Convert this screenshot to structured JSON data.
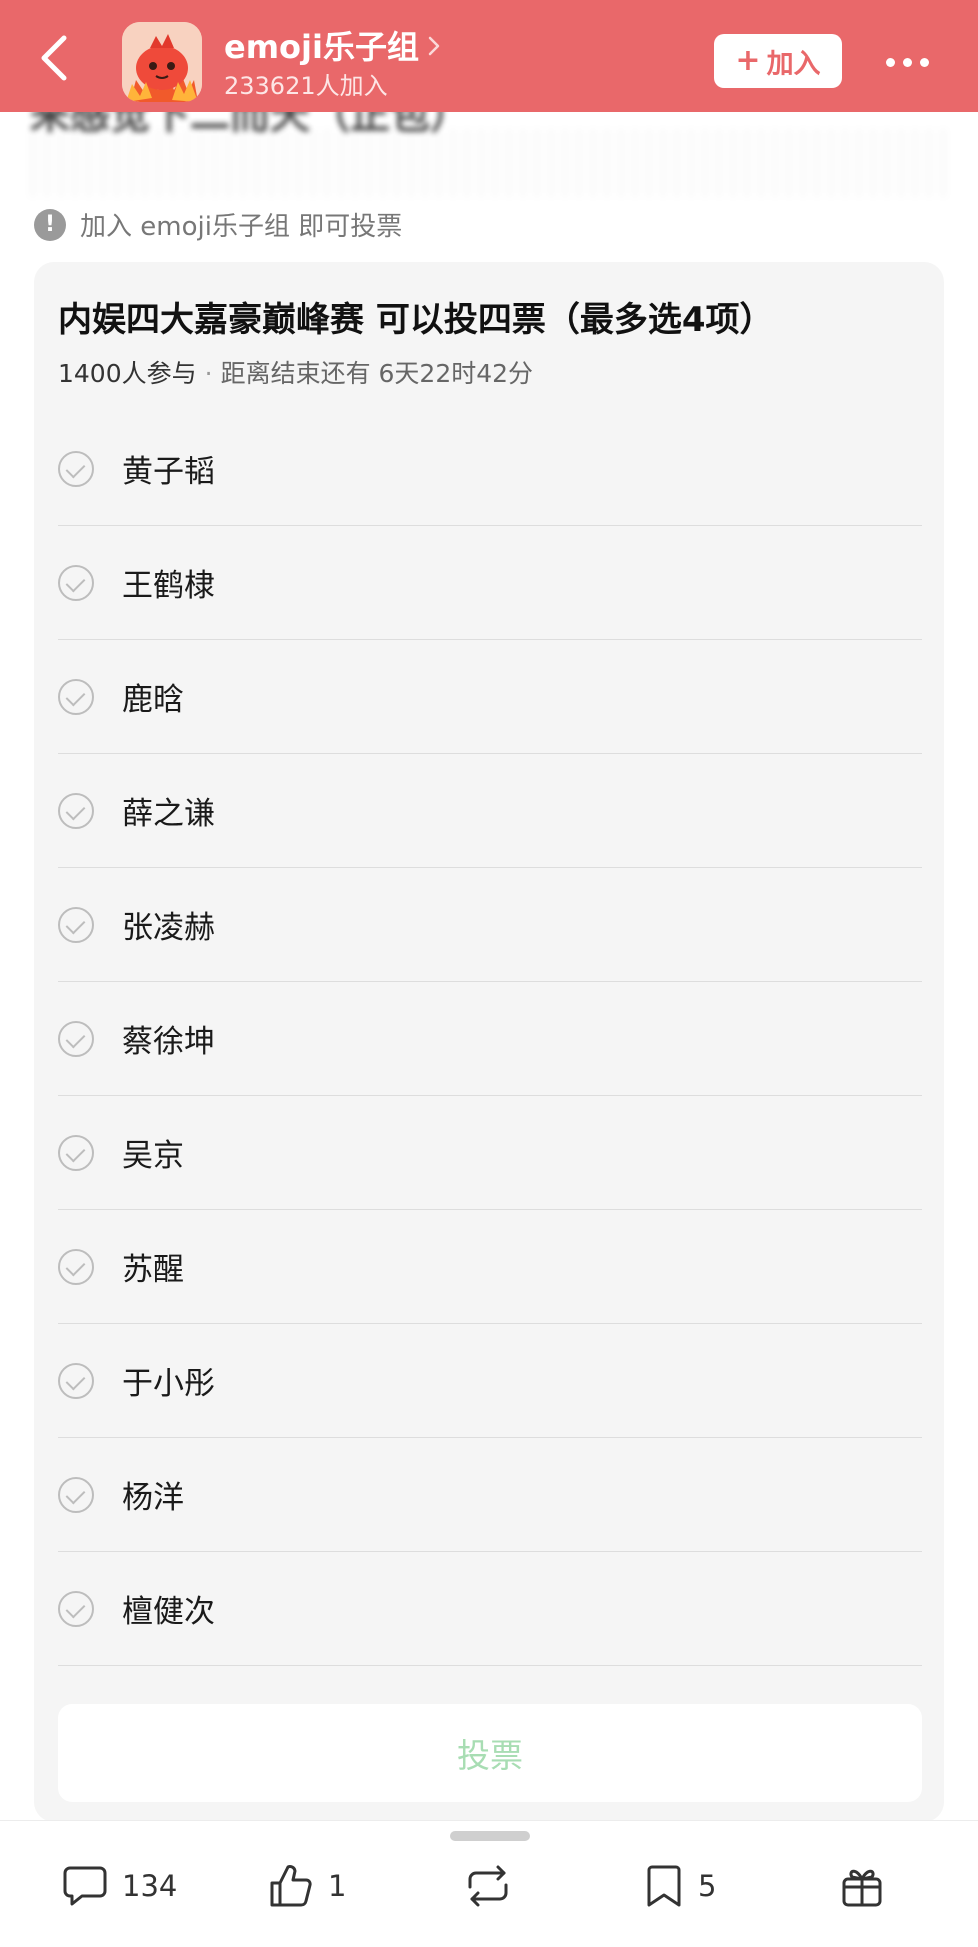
{
  "header": {
    "group_name": "emoji乐子组",
    "member_count": "233621人加入",
    "join_label": "加入",
    "join_plus": "+",
    "accent_color": "#e9686a"
  },
  "background_title": "来感觉下二而天（正包）",
  "notice": {
    "icon_glyph": "!",
    "text": "加入 emoji乐子组 即可投票"
  },
  "poll": {
    "title": "内娱四大嘉豪巅峰赛 可以投四票（最多选4项）",
    "participants": "1400人参与",
    "separator": "·",
    "remaining": "距离结束还有 6天22时42分",
    "options": [
      "黄子韬",
      "王鹤棣",
      "鹿晗",
      "薛之谦",
      "张凌赫",
      "蔡徐坤",
      "吴京",
      "苏醒",
      "于小彤",
      "杨洋",
      "檀健次"
    ],
    "vote_label": "投票",
    "vote_color": "#a8ddb3"
  },
  "actions": {
    "comment_count": "134",
    "like_count": "1",
    "favorite_count": "5"
  },
  "icons": [
    "back-icon",
    "avatar",
    "chevron-right-icon",
    "more-icon",
    "info-icon",
    "check-icon",
    "comment-icon",
    "like-icon",
    "repost-icon",
    "bookmark-icon",
    "gift-icon"
  ]
}
